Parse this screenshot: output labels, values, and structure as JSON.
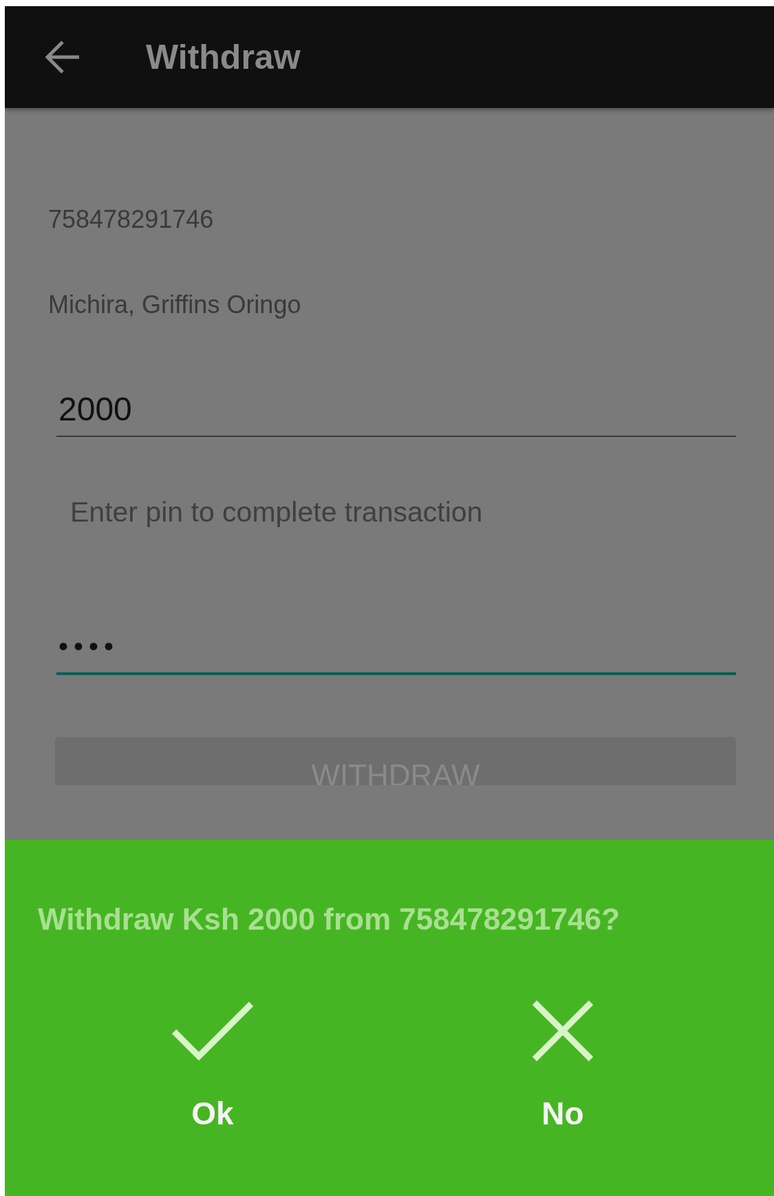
{
  "app_bar": {
    "title": "Withdraw"
  },
  "account_number": "758478291746",
  "account_name": "Michira, Griffins Oringo",
  "amount_field": {
    "value": "2000",
    "focused": false
  },
  "pin_prompt": "Enter pin to complete transaction",
  "pin_field": {
    "value": "••••",
    "focused": true
  },
  "withdraw_button": {
    "label": "WITHDRAW",
    "disabled": true
  },
  "confirm_sheet": {
    "message": "Withdraw Ksh 2000 from 758478291746?",
    "actions": [
      {
        "kind": "confirm",
        "label": "Ok"
      },
      {
        "kind": "cancel",
        "label": "No"
      }
    ]
  }
}
